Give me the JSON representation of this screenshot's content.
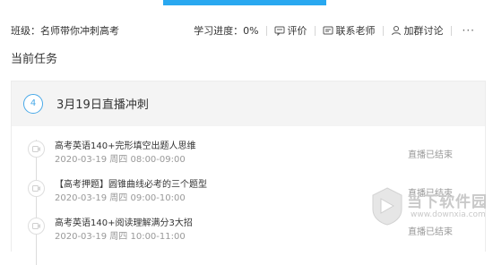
{
  "header": {
    "class_label": "班级：名师带你冲刺高考",
    "progress": "学习进度：0%",
    "review": "评价",
    "contact_teacher": "联系老师",
    "join_group": "加群讨论",
    "more": "···"
  },
  "section_title": "当前任务",
  "task": {
    "number": "4",
    "title": "3月19日直播冲刺",
    "lessons": [
      {
        "title": "高考英语140+完形填空出题人思维",
        "time": "2020-03-19 周四 08:00-09:00",
        "status": "直播已结束"
      },
      {
        "title": "【高考押题】圆锥曲线必考的三个题型",
        "time": "2020-03-19 周四 09:00-10:00",
        "status": "直播已结束"
      },
      {
        "title": "高考英语140+阅读理解满分3大招",
        "time": "2020-03-19 周四 10:00-11:00",
        "status": "直播已结束"
      }
    ]
  },
  "watermark": {
    "name": "当下软件园",
    "url": "www.downxia.com"
  },
  "colors": {
    "accent": "#29a8f0",
    "step_circle": "#49a9e8",
    "muted_text": "#999999"
  }
}
